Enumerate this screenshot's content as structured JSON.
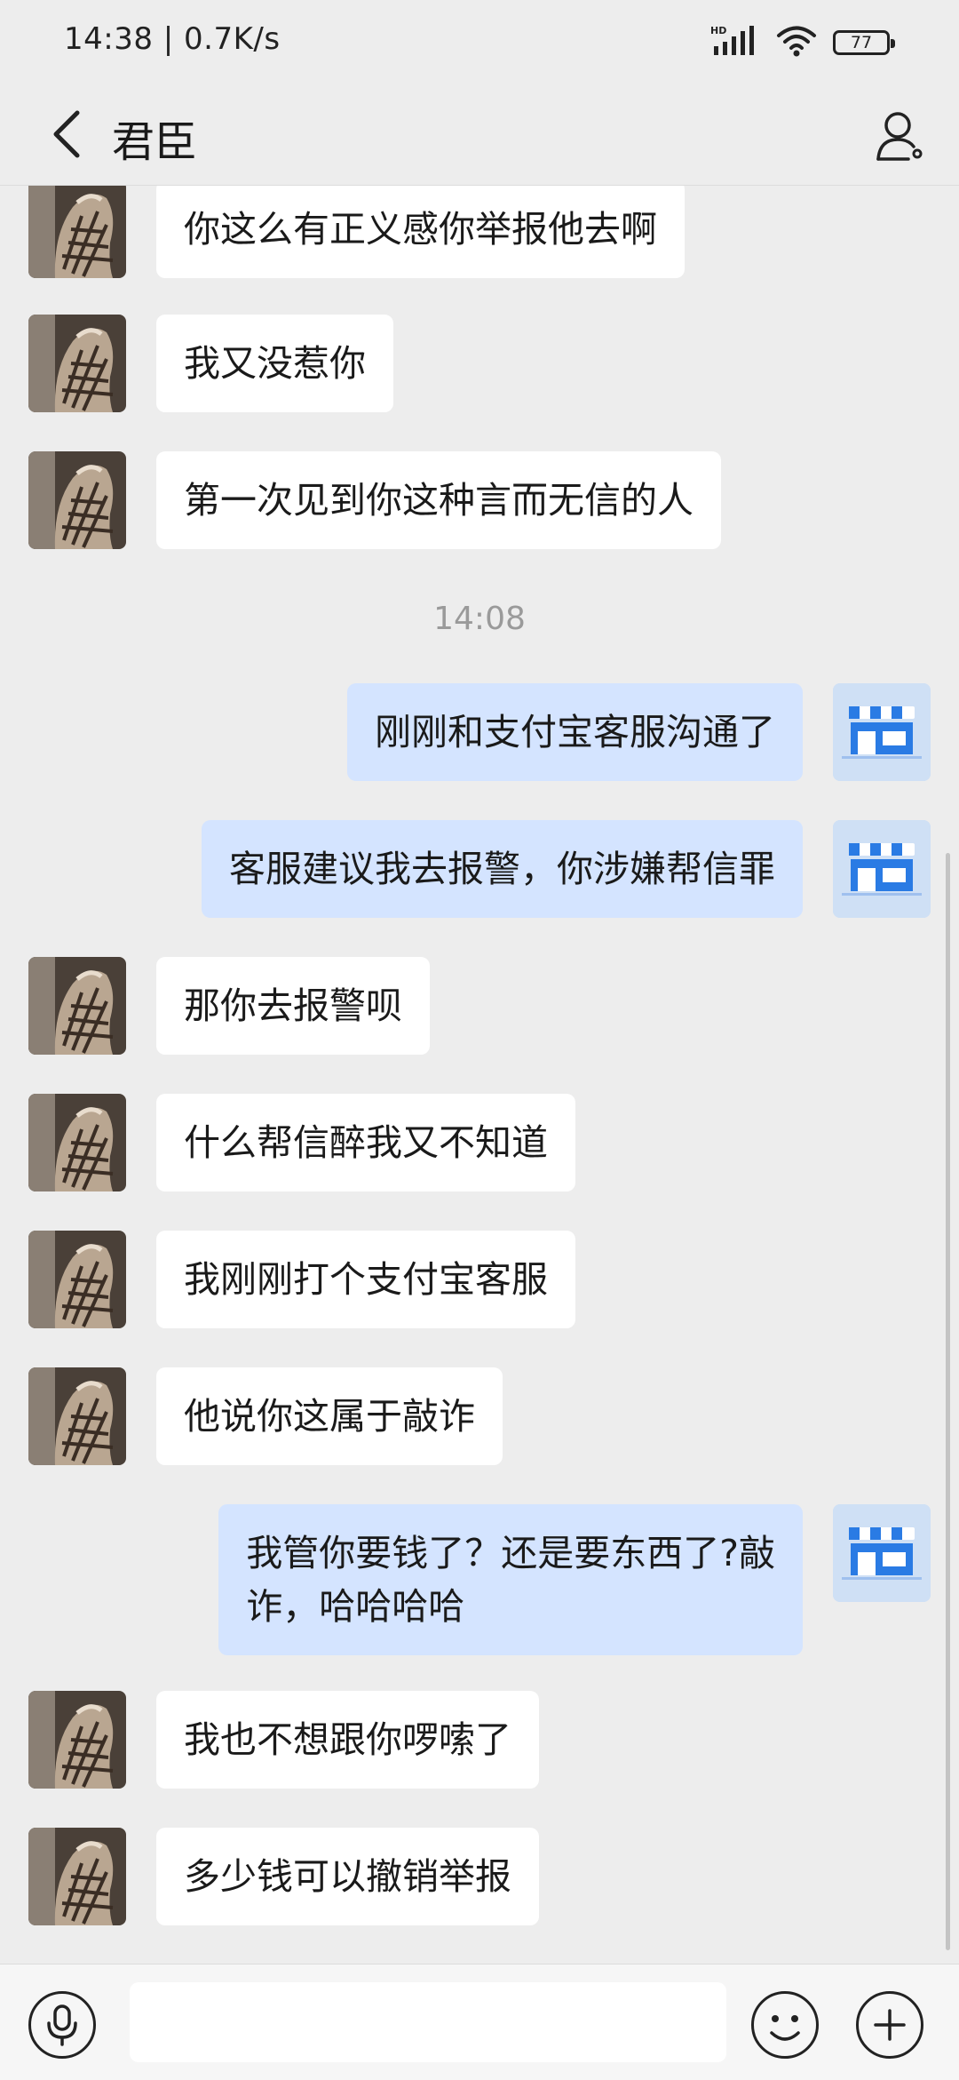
{
  "status_bar": {
    "time": "14:38 | 0.7K/s",
    "network": "HD",
    "battery": "77"
  },
  "header": {
    "title": "君臣"
  },
  "messages": [
    {
      "from": "them",
      "text": "你这么有正义感你举报他去啊"
    },
    {
      "from": "them",
      "text": "我又没惹你"
    },
    {
      "from": "them",
      "text": "第一次见到你这种言而无信的人"
    },
    {
      "type": "time",
      "text": "14:08"
    },
    {
      "from": "me",
      "text": "刚刚和支付宝客服沟通了"
    },
    {
      "from": "me",
      "text": "客服建议我去报警，你涉嫌帮信罪"
    },
    {
      "from": "them",
      "text": "那你去报警呗"
    },
    {
      "from": "them",
      "text": "什么帮信醉我又不知道"
    },
    {
      "from": "them",
      "text": "我刚刚打个支付宝客服"
    },
    {
      "from": "them",
      "text": "他说你这属于敲诈"
    },
    {
      "from": "me",
      "text": "我管你要钱了？还是要东西了?敲\n诈，哈哈哈哈"
    },
    {
      "from": "them",
      "text": "我也不想跟你啰嗦了"
    },
    {
      "from": "them",
      "text": "多少钱可以撤销举报"
    }
  ],
  "input_bar": {
    "message_value": "",
    "message_placeholder": ""
  },
  "icons": {
    "back": "back-arrow-icon",
    "profile": "person-icon",
    "voice": "microphone-icon",
    "emoji": "smiley-icon",
    "more": "plus-icon",
    "my_avatar": "storefront-icon"
  },
  "colors": {
    "background": "#ededed",
    "incoming_bubble": "#ffffff",
    "outgoing_bubble": "#d4e4ff",
    "timestamp": "#9a9a9a"
  }
}
